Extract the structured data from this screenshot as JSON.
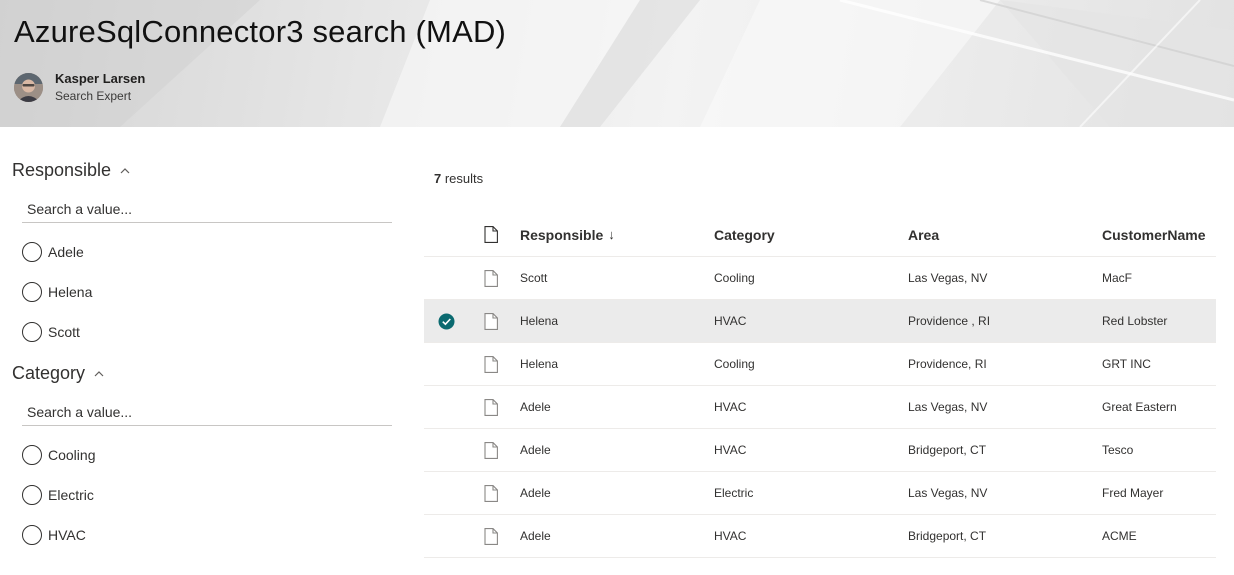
{
  "header": {
    "title": "AzureSqlConnector3 search (MAD)",
    "author": {
      "name": "Kasper Larsen",
      "role": "Search Expert"
    }
  },
  "refiners": [
    {
      "heading": "Responsible",
      "search_placeholder": "Search a value...",
      "options": [
        "Adele",
        "Helena",
        "Scott"
      ]
    },
    {
      "heading": "Category",
      "search_placeholder": "Search a value...",
      "options": [
        "Cooling",
        "Electric",
        "HVAC"
      ]
    }
  ],
  "results": {
    "count": "7",
    "count_suffix": " results",
    "sort": {
      "column": "Responsible",
      "direction": "descending"
    },
    "columns": {
      "responsible": "Responsible",
      "category": "Category",
      "area": "Area",
      "customer": "CustomerName"
    },
    "rows": [
      {
        "responsible": "Scott",
        "category": "Cooling",
        "area": "Las Vegas, NV",
        "customer": "MacF",
        "selected": false
      },
      {
        "responsible": "Helena",
        "category": "HVAC",
        "area": "Providence , RI",
        "customer": "Red Lobster",
        "selected": true
      },
      {
        "responsible": "Helena",
        "category": "Cooling",
        "area": "Providence, RI",
        "customer": "GRT INC",
        "selected": false
      },
      {
        "responsible": "Adele",
        "category": "HVAC",
        "area": "Las Vegas, NV",
        "customer": "Great Eastern",
        "selected": false
      },
      {
        "responsible": "Adele",
        "category": "HVAC",
        "area": "Bridgeport, CT",
        "customer": "Tesco",
        "selected": false
      },
      {
        "responsible": "Adele",
        "category": "Electric",
        "area": "Las Vegas, NV",
        "customer": "Fred Mayer",
        "selected": false
      },
      {
        "responsible": "Adele",
        "category": "HVAC",
        "area": "Bridgeport, CT",
        "customer": "ACME",
        "selected": false
      }
    ]
  },
  "colors": {
    "selected_check": "#0b6a70",
    "selected_row": "#ebebeb",
    "divider": "#edebe9"
  },
  "icons": {
    "refiner_toggle": "chevron-up-icon",
    "row_type": "document-icon",
    "header_type": "document-icon",
    "selected": "check-circle-icon",
    "sort": "arrow-down-icon"
  }
}
